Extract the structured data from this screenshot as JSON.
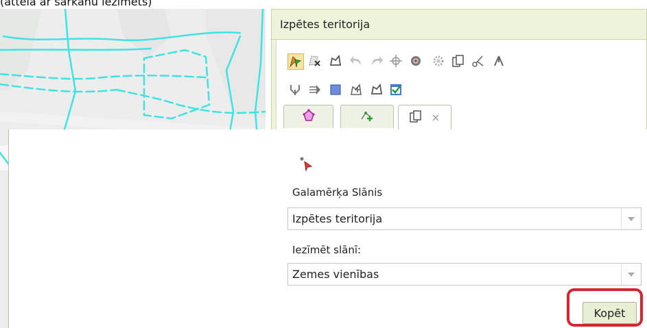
{
  "caption": "(attēlā ar sarkanu iezīmēts)",
  "panel": {
    "title": "Izpētes teritorija"
  },
  "toolbar": {
    "row1": [
      "select-edit-icon",
      "delete-feature-icon",
      "polygon-edit-icon",
      "undo-icon",
      "redo-icon",
      "crosshair-icon",
      "add-point-icon",
      "settings-icon",
      "copy-icon",
      "cut-icon",
      "split-icon"
    ],
    "row2": [
      "merge-icon",
      "move-icon",
      "square-icon",
      "polygon-add-icon",
      "polygon-icon",
      "save-check-icon"
    ]
  },
  "tabs": [
    {
      "icon": "shapes-icon"
    },
    {
      "icon": "add-node-icon"
    },
    {
      "icon": "copy-icon",
      "close": "×"
    }
  ],
  "form": {
    "target_layer_label": "Galamērķa Slānis",
    "target_layer_value": "Izpētes teritorija",
    "select_layer_label": "Iezīmēt slānī:",
    "select_layer_value": "Zemes vienības",
    "copy_button": "Kopēt"
  },
  "colors": {
    "panel_bg": "#eef3dc",
    "map_bg": "#ededed",
    "map_road": "#ffffff",
    "map_lines": "#3ee3e3",
    "polygon_fill": "#6a6ef0",
    "polygon_stroke": "#1526b0",
    "highlight": "#d9232f"
  }
}
